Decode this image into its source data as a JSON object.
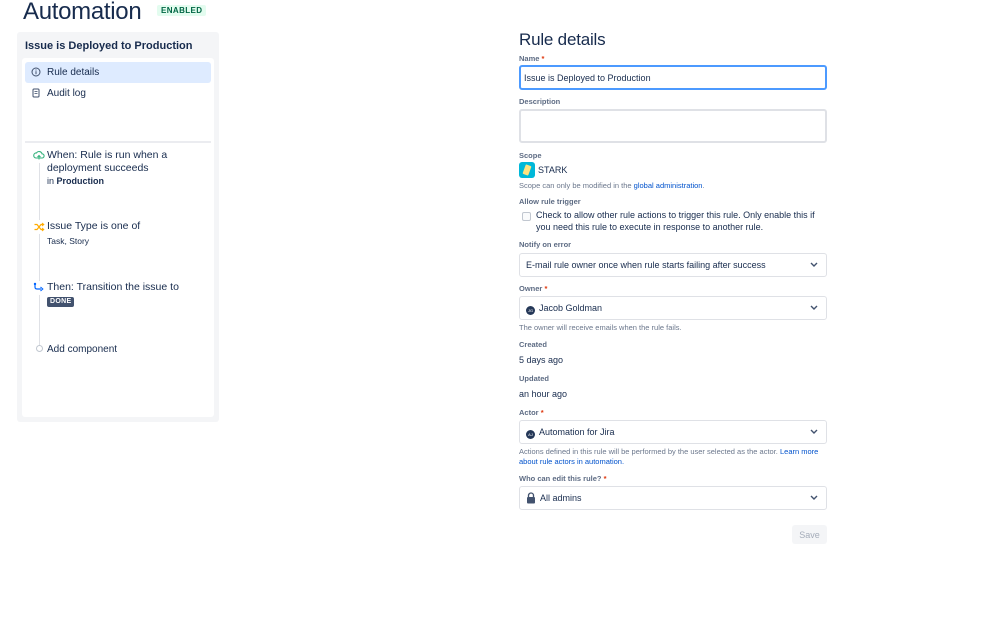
{
  "header": {
    "title": "Automation",
    "status_badge": "ENABLED"
  },
  "sidebar": {
    "rule_title": "Issue is Deployed to Production",
    "nav": [
      {
        "label": "Rule details",
        "icon": "info-icon",
        "active": true
      },
      {
        "label": "Audit log",
        "icon": "document-icon",
        "active": false
      }
    ],
    "components": [
      {
        "kind": "trigger",
        "icon": "deployment-cloud-icon",
        "title": "When: Rule is run when a deployment succeeds",
        "prefix": "in",
        "emphasis": "Production"
      },
      {
        "kind": "condition",
        "icon": "shuffle-icon",
        "title": "Issue Type is one of",
        "detail": "Task, Story"
      },
      {
        "kind": "action",
        "icon": "transition-icon",
        "title": "Then: Transition the issue to",
        "badge": "DONE"
      }
    ],
    "add_component": "Add component"
  },
  "form": {
    "title": "Rule details",
    "name": {
      "label": "Name",
      "required": "*",
      "value": "Issue is Deployed to Production"
    },
    "description": {
      "label": "Description",
      "value": ""
    },
    "scope": {
      "label": "Scope",
      "project": "STARK",
      "helper_prefix": "Scope can only be modified in the ",
      "helper_link": "global administration",
      "helper_suffix": "."
    },
    "allow_trigger": {
      "label": "Allow rule trigger",
      "checked": false,
      "text": "Check to allow other rule actions to trigger this rule. Only enable this if you need this rule to execute in response to another rule."
    },
    "notify": {
      "label": "Notify on error",
      "value": "E-mail rule owner once when rule starts failing after success"
    },
    "owner": {
      "label": "Owner",
      "required": "*",
      "avatar": "JG",
      "value": "Jacob Goldman",
      "helper": "The owner will receive emails when the rule fails."
    },
    "created": {
      "label": "Created",
      "value": "5 days ago"
    },
    "updated": {
      "label": "Updated",
      "value": "an hour ago"
    },
    "actor": {
      "label": "Actor",
      "required": "*",
      "avatar": "AJ",
      "value": "Automation for Jira",
      "helper_prefix": "Actions defined in this rule will be performed by the user selected as the actor. ",
      "helper_link": "Learn more about rule actors in automation."
    },
    "who_can_edit": {
      "label": "Who can edit this rule?",
      "required": "*",
      "value": "All admins"
    },
    "save_label": "Save"
  },
  "colors": {
    "accent": "#0052CC",
    "focus_border": "#4C9AFF",
    "nav_active_bg": "#DEEBFF",
    "enabled_badge_text": "#006644",
    "enabled_badge_bg": "#E3FCEF",
    "done_badge_bg": "#42526E",
    "trigger_icon": "#36B37E",
    "condition_icon": "#FFAB00",
    "action_icon": "#0065FF"
  }
}
